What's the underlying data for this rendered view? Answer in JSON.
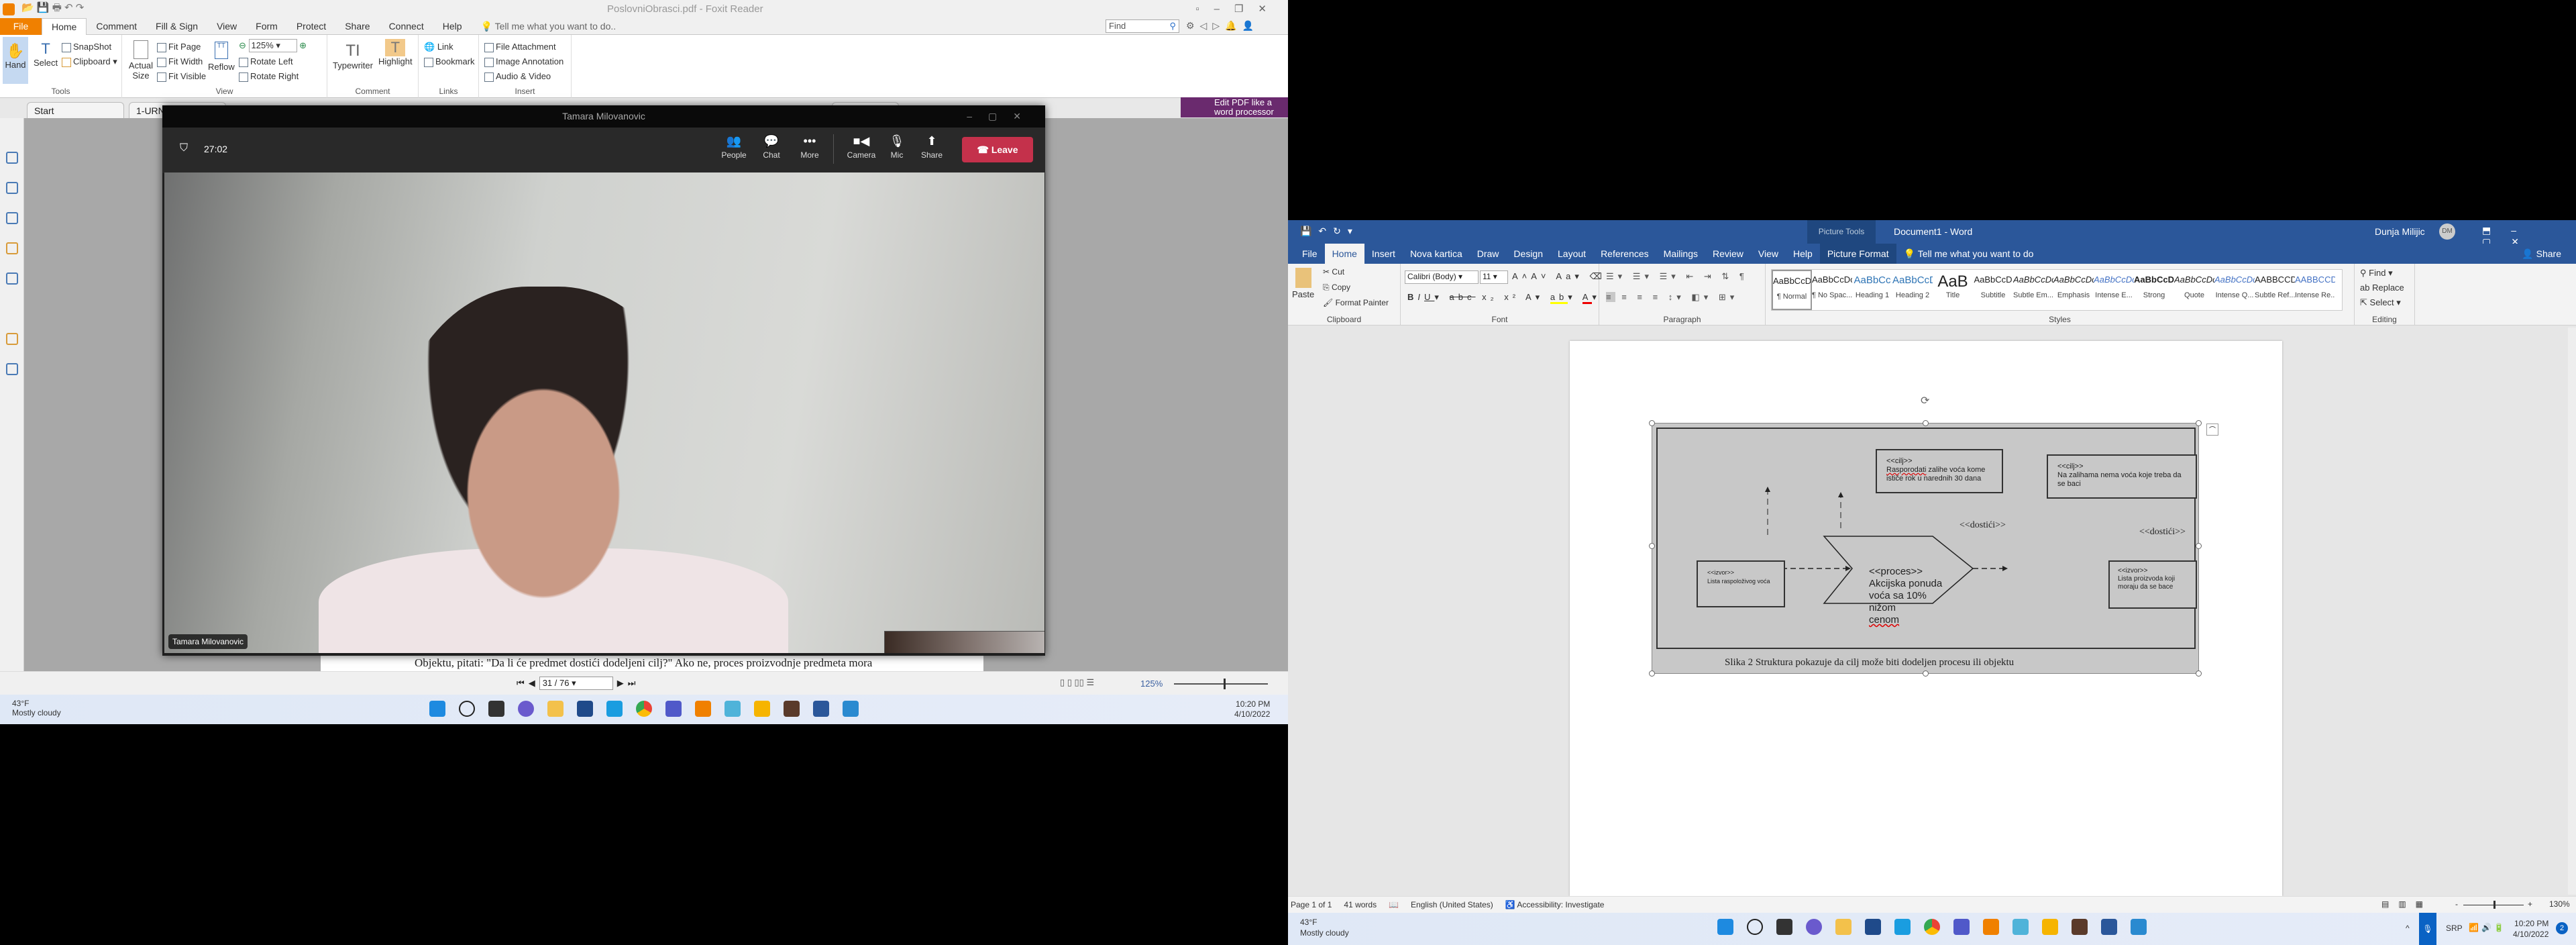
{
  "foxit": {
    "title": "PoslovniObrasci.pdf - Foxit Reader",
    "tabs": [
      "File",
      "Home",
      "Comment",
      "Fill & Sign",
      "View",
      "Form",
      "Protect",
      "Share",
      "Connect",
      "Help"
    ],
    "tell_me": "Tell me what you want to do..",
    "find_placeholder": "Find",
    "ribbon": {
      "hand": "Hand",
      "select": "Select",
      "snapshot": "SnapShot",
      "clipboard": "Clipboard",
      "tools": "Tools",
      "actual_size": "Actual Size",
      "fit_page": "Fit Page",
      "fit_width": "Fit Width",
      "fit_visible": "Fit Visible",
      "reflow": "Reflow",
      "zoom": "125%",
      "rotate_left": "Rotate Left",
      "rotate_right": "Rotate Right",
      "view": "View",
      "typewriter": "Typewriter",
      "highlight": "Highlight",
      "comment": "Comment",
      "link": "Link",
      "bookmark": "Bookmark",
      "links": "Links",
      "file_attachment": "File Attachment",
      "image_annotation": "Image Annotation",
      "audio_video": "Audio & Video",
      "insert": "Insert"
    },
    "doc_tabs": [
      "Start",
      "1-URN"
    ],
    "promo": "Edit PDF like a word processor",
    "page_text_1": "Objektu, pitati: \"Da li će predmet dostići dodeljeni cilj?\" Ako ne, proces proizvodnje predmeta mora",
    "page_nav": "31 / 76",
    "zoom_status": "125%"
  },
  "teams": {
    "title": "Tamara Milovanovic",
    "timer": "27:02",
    "buttons": {
      "people": "People",
      "chat": "Chat",
      "more": "More",
      "camera": "Camera",
      "mic": "Mic",
      "share": "Share",
      "leave": "Leave"
    },
    "participant": "Tamara Milovanovic"
  },
  "left_taskbar": {
    "weather_temp": "43°F",
    "weather_desc": "Mostly cloudy",
    "time": "10:20 PM",
    "date": "4/10/2022"
  },
  "word": {
    "picture_tools": "Picture Tools",
    "title": "Document1 - Word",
    "user": "Dunja Milijic",
    "initials": "DM",
    "tabs": [
      "File",
      "Home",
      "Insert",
      "Nova kartica",
      "Draw",
      "Design",
      "Layout",
      "References",
      "Mailings",
      "Review",
      "View",
      "Help",
      "Picture Format"
    ],
    "tell_me": "Tell me what you want to do",
    "share": "Share",
    "clipboard": {
      "paste": "Paste",
      "cut": "Cut",
      "copy": "Copy",
      "format_painter": "Format Painter",
      "label": "Clipboard"
    },
    "font": {
      "name": "Calibri (Body)",
      "size": "11",
      "label": "Font"
    },
    "paragraph_label": "Paragraph",
    "styles": [
      {
        "preview": "AaBbCcDc",
        "name": "¶ Normal"
      },
      {
        "preview": "AaBbCcDc",
        "name": "¶ No Spac..."
      },
      {
        "preview": "AaBbCc",
        "name": "Heading 1"
      },
      {
        "preview": "AaBbCcD",
        "name": "Heading 2"
      },
      {
        "preview": "AaB",
        "name": "Title"
      },
      {
        "preview": "AaBbCcD",
        "name": "Subtitle"
      },
      {
        "preview": "AaBbCcDc",
        "name": "Subtle Em..."
      },
      {
        "preview": "AaBbCcDc",
        "name": "Emphasis"
      },
      {
        "preview": "AaBbCcDc",
        "name": "Intense E..."
      },
      {
        "preview": "AaBbCcDc",
        "name": "Strong"
      },
      {
        "preview": "AaBbCcDc",
        "name": "Quote"
      },
      {
        "preview": "AaBbCcDc",
        "name": "Intense Q..."
      },
      {
        "preview": "AABBCCDC",
        "name": "Subtle Ref..."
      },
      {
        "preview": "AABBCCDC",
        "name": "Intense Re..."
      }
    ],
    "styles_label": "Styles",
    "editing": {
      "find": "Find",
      "replace": "Replace",
      "select": "Select",
      "label": "Editing"
    },
    "diagram": {
      "goal1_stereo": "<<cilj>>",
      "goal1_word": "Rasporodati",
      "goal1_rest": " zalihe voća kome ističe rok u narednih 30 dana",
      "goal2_stereo": "<<cilj>>",
      "goal2_text": "Na zalihama nema voća koje treba da se baci",
      "achieve1": "<<dostići>>",
      "achieve2": "<<dostići>>",
      "source1_stereo": "<<izvor>>",
      "source1_text": "Lista raspoloživog voća",
      "process_stereo": "<<proces>>",
      "process_text": "Akcijska ponuda voća sa 10% nižom",
      "process_last": "cenom",
      "source2_stereo": "<<izvor>>",
      "source2_text": "Lista proizvoda koji moraju da se bace",
      "caption": "Slika 2 Struktura pokazuje da cilj može biti dodeljen procesu ili objektu"
    },
    "status": {
      "page": "Page 1 of 1",
      "words": "41 words",
      "language": "English (United States)",
      "accessibility": "Accessibility: Investigate",
      "zoom": "130%"
    }
  },
  "right_taskbar": {
    "weather_temp": "43°F",
    "weather_desc": "Mostly cloudy",
    "lang": "SRP",
    "time": "10:20 PM",
    "date": "4/10/2022",
    "notifications": "2"
  }
}
